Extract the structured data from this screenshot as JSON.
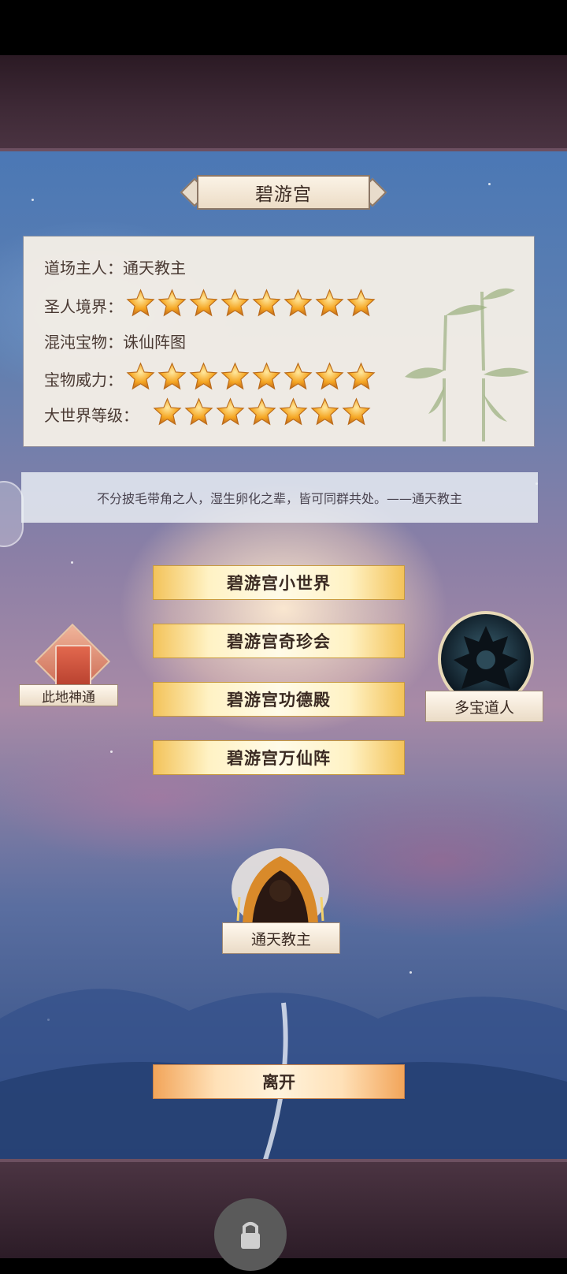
{
  "location_title": "碧游宫",
  "info": {
    "owner_label": "道场主人：",
    "owner_value": "通天教主",
    "saint_label": "圣人境界：",
    "saint_stars": 8,
    "treasure_label": "混沌宝物：",
    "treasure_value": "诛仙阵图",
    "power_label": "宝物威力：",
    "power_stars": 8,
    "world_label": "大世界等级：",
    "world_stars": 7
  },
  "quote": "不分披毛带角之人，湿生卵化之辈，皆可同群共处。——通天教主",
  "menu": [
    {
      "label": "碧游宫小世界"
    },
    {
      "label": "碧游宫奇珍会"
    },
    {
      "label": "碧游宫功德殿"
    },
    {
      "label": "碧游宫万仙阵"
    }
  ],
  "left_feature": {
    "label": "此地神通",
    "icon": "book-icon"
  },
  "right_npc": {
    "label": "多宝道人",
    "icon": "npc-portrait"
  },
  "center_npc": {
    "label": "通天教主",
    "icon": "saint-portrait"
  },
  "leave_label": "离开",
  "colors": {
    "star": "#f5a623",
    "gold_button": "#f3c35a",
    "leave_button": "#f2a55a"
  }
}
